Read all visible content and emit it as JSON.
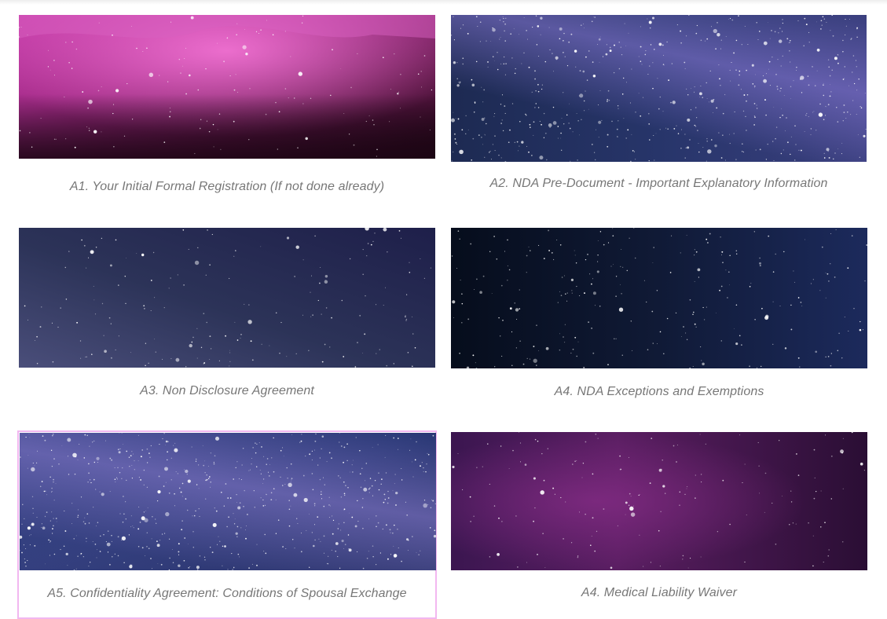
{
  "cards": [
    {
      "id": "a1",
      "title": "A1. Your Initial Formal Registration (If not done already)",
      "image": "magenta-nebula-image"
    },
    {
      "id": "a2",
      "title": "A2. NDA Pre-Document - Important Explanatory Information",
      "image": "milky-way-image"
    },
    {
      "id": "a3",
      "title": "A3. Non Disclosure Agreement",
      "image": "starfield-image"
    },
    {
      "id": "a4",
      "title": "A4. NDA Exceptions and Exemptions",
      "image": "dark-starfield-image"
    },
    {
      "id": "a5",
      "title": "A5. Confidentiality Agreement: Conditions of Spousal Exchange",
      "image": "blue-milky-way-image"
    },
    {
      "id": "a6",
      "title": "A4. Medical Liability Waiver",
      "image": "purple-nebula-image"
    }
  ],
  "colors": {
    "caption": "#777777",
    "highlight_border": "#f2b7f0"
  }
}
